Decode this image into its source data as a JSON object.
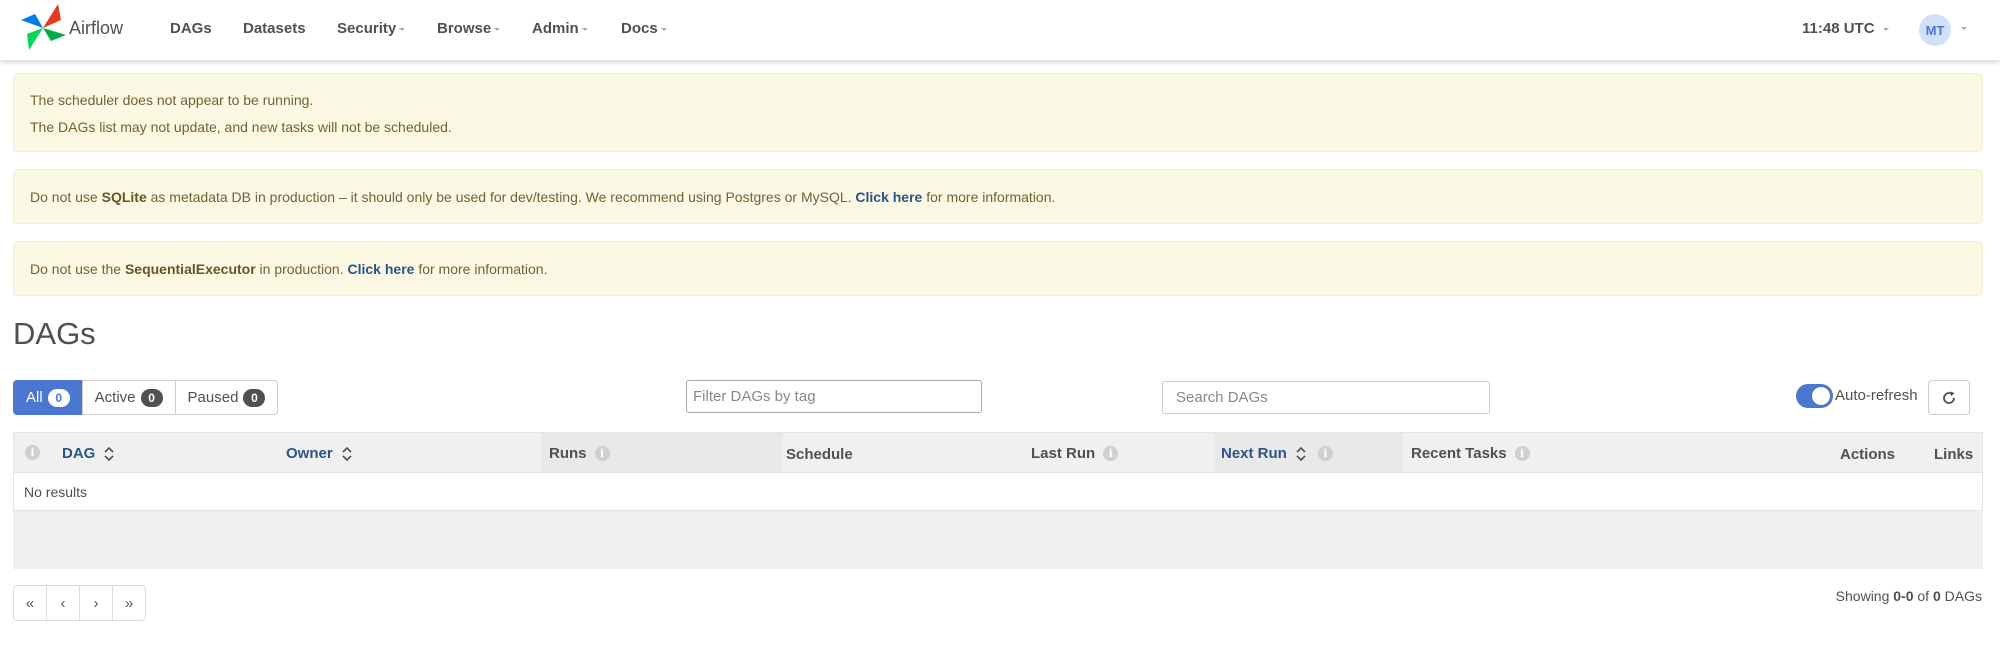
{
  "nav": {
    "brand": "Airflow",
    "items": [
      {
        "label": "DAGs",
        "dropdown": false
      },
      {
        "label": "Datasets",
        "dropdown": false
      },
      {
        "label": "Security",
        "dropdown": true
      },
      {
        "label": "Browse",
        "dropdown": true
      },
      {
        "label": "Admin",
        "dropdown": true
      },
      {
        "label": "Docs",
        "dropdown": true
      }
    ],
    "time": "11:48 UTC",
    "user_initials": "MT"
  },
  "alerts": {
    "scheduler": {
      "line1": "The scheduler does not appear to be running.",
      "line2": "The DAGs list may not update, and new tasks will not be scheduled."
    },
    "sqlite": {
      "pre": "Do not use ",
      "strong": "SQLite",
      "mid": " as metadata DB in production – it should only be used for dev/testing. We recommend using Postgres or MySQL. ",
      "link": "Click here",
      "post": " for more information."
    },
    "executor": {
      "pre": "Do not use the ",
      "strong": "SequentialExecutor",
      "mid": " in production. ",
      "link": "Click here",
      "post": " for more information."
    }
  },
  "page_title": "DAGs",
  "filters": {
    "all": {
      "label": "All",
      "count": "0"
    },
    "active": {
      "label": "Active",
      "count": "0"
    },
    "paused": {
      "label": "Paused",
      "count": "0"
    }
  },
  "tag_filter_placeholder": "Filter DAGs by tag",
  "search_placeholder": "Search DAGs",
  "auto_refresh_label": "Auto-refresh",
  "auto_refresh_on": true,
  "table": {
    "columns": {
      "dag": "DAG",
      "owner": "Owner",
      "runs": "Runs",
      "schedule": "Schedule",
      "last_run": "Last Run",
      "next_run": "Next Run",
      "recent_tasks": "Recent Tasks",
      "actions": "Actions",
      "links": "Links"
    },
    "empty_text": "No results"
  },
  "pagination": {
    "first": "«",
    "prev": "‹",
    "next": "›",
    "last": "»"
  },
  "showing": {
    "prefix": "Showing ",
    "range": "0-0",
    "of": " of ",
    "total": "0",
    "suffix": " DAGs"
  },
  "colors": {
    "accent": "#4b77d1",
    "alert_bg": "#fbf8e3",
    "link": "#2b5489"
  }
}
